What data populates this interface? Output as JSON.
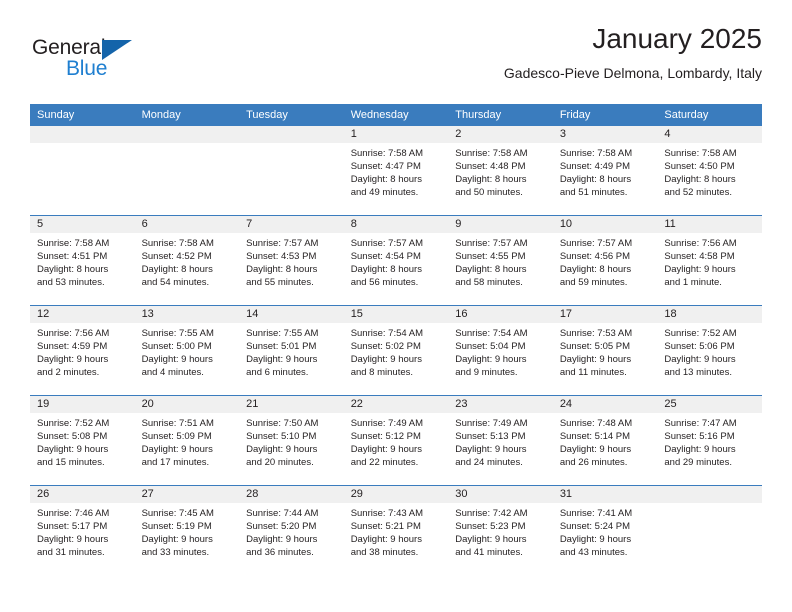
{
  "brand": {
    "name_part1": "General",
    "name_part2": "Blue",
    "triangle_color": "#1464aa",
    "blue_color": "#1f7fd0"
  },
  "header": {
    "title": "January 2025",
    "subtitle": "Gadesco-Pieve Delmona, Lombardy, Italy"
  },
  "theme": {
    "header_row_bg": "#3a7cbe",
    "daynum_bg": "#f0f0f0",
    "text_color": "#231f20"
  },
  "weekday_headers": [
    "Sunday",
    "Monday",
    "Tuesday",
    "Wednesday",
    "Thursday",
    "Friday",
    "Saturday"
  ],
  "weeks": [
    [
      {
        "day": "",
        "sunrise": "",
        "sunset": "",
        "daylight_line1": "",
        "daylight_line2": ""
      },
      {
        "day": "",
        "sunrise": "",
        "sunset": "",
        "daylight_line1": "",
        "daylight_line2": ""
      },
      {
        "day": "",
        "sunrise": "",
        "sunset": "",
        "daylight_line1": "",
        "daylight_line2": ""
      },
      {
        "day": "1",
        "sunrise": "Sunrise: 7:58 AM",
        "sunset": "Sunset: 4:47 PM",
        "daylight_line1": "Daylight: 8 hours",
        "daylight_line2": "and 49 minutes."
      },
      {
        "day": "2",
        "sunrise": "Sunrise: 7:58 AM",
        "sunset": "Sunset: 4:48 PM",
        "daylight_line1": "Daylight: 8 hours",
        "daylight_line2": "and 50 minutes."
      },
      {
        "day": "3",
        "sunrise": "Sunrise: 7:58 AM",
        "sunset": "Sunset: 4:49 PM",
        "daylight_line1": "Daylight: 8 hours",
        "daylight_line2": "and 51 minutes."
      },
      {
        "day": "4",
        "sunrise": "Sunrise: 7:58 AM",
        "sunset": "Sunset: 4:50 PM",
        "daylight_line1": "Daylight: 8 hours",
        "daylight_line2": "and 52 minutes."
      }
    ],
    [
      {
        "day": "5",
        "sunrise": "Sunrise: 7:58 AM",
        "sunset": "Sunset: 4:51 PM",
        "daylight_line1": "Daylight: 8 hours",
        "daylight_line2": "and 53 minutes."
      },
      {
        "day": "6",
        "sunrise": "Sunrise: 7:58 AM",
        "sunset": "Sunset: 4:52 PM",
        "daylight_line1": "Daylight: 8 hours",
        "daylight_line2": "and 54 minutes."
      },
      {
        "day": "7",
        "sunrise": "Sunrise: 7:57 AM",
        "sunset": "Sunset: 4:53 PM",
        "daylight_line1": "Daylight: 8 hours",
        "daylight_line2": "and 55 minutes."
      },
      {
        "day": "8",
        "sunrise": "Sunrise: 7:57 AM",
        "sunset": "Sunset: 4:54 PM",
        "daylight_line1": "Daylight: 8 hours",
        "daylight_line2": "and 56 minutes."
      },
      {
        "day": "9",
        "sunrise": "Sunrise: 7:57 AM",
        "sunset": "Sunset: 4:55 PM",
        "daylight_line1": "Daylight: 8 hours",
        "daylight_line2": "and 58 minutes."
      },
      {
        "day": "10",
        "sunrise": "Sunrise: 7:57 AM",
        "sunset": "Sunset: 4:56 PM",
        "daylight_line1": "Daylight: 8 hours",
        "daylight_line2": "and 59 minutes."
      },
      {
        "day": "11",
        "sunrise": "Sunrise: 7:56 AM",
        "sunset": "Sunset: 4:58 PM",
        "daylight_line1": "Daylight: 9 hours",
        "daylight_line2": "and 1 minute."
      }
    ],
    [
      {
        "day": "12",
        "sunrise": "Sunrise: 7:56 AM",
        "sunset": "Sunset: 4:59 PM",
        "daylight_line1": "Daylight: 9 hours",
        "daylight_line2": "and 2 minutes."
      },
      {
        "day": "13",
        "sunrise": "Sunrise: 7:55 AM",
        "sunset": "Sunset: 5:00 PM",
        "daylight_line1": "Daylight: 9 hours",
        "daylight_line2": "and 4 minutes."
      },
      {
        "day": "14",
        "sunrise": "Sunrise: 7:55 AM",
        "sunset": "Sunset: 5:01 PM",
        "daylight_line1": "Daylight: 9 hours",
        "daylight_line2": "and 6 minutes."
      },
      {
        "day": "15",
        "sunrise": "Sunrise: 7:54 AM",
        "sunset": "Sunset: 5:02 PM",
        "daylight_line1": "Daylight: 9 hours",
        "daylight_line2": "and 8 minutes."
      },
      {
        "day": "16",
        "sunrise": "Sunrise: 7:54 AM",
        "sunset": "Sunset: 5:04 PM",
        "daylight_line1": "Daylight: 9 hours",
        "daylight_line2": "and 9 minutes."
      },
      {
        "day": "17",
        "sunrise": "Sunrise: 7:53 AM",
        "sunset": "Sunset: 5:05 PM",
        "daylight_line1": "Daylight: 9 hours",
        "daylight_line2": "and 11 minutes."
      },
      {
        "day": "18",
        "sunrise": "Sunrise: 7:52 AM",
        "sunset": "Sunset: 5:06 PM",
        "daylight_line1": "Daylight: 9 hours",
        "daylight_line2": "and 13 minutes."
      }
    ],
    [
      {
        "day": "19",
        "sunrise": "Sunrise: 7:52 AM",
        "sunset": "Sunset: 5:08 PM",
        "daylight_line1": "Daylight: 9 hours",
        "daylight_line2": "and 15 minutes."
      },
      {
        "day": "20",
        "sunrise": "Sunrise: 7:51 AM",
        "sunset": "Sunset: 5:09 PM",
        "daylight_line1": "Daylight: 9 hours",
        "daylight_line2": "and 17 minutes."
      },
      {
        "day": "21",
        "sunrise": "Sunrise: 7:50 AM",
        "sunset": "Sunset: 5:10 PM",
        "daylight_line1": "Daylight: 9 hours",
        "daylight_line2": "and 20 minutes."
      },
      {
        "day": "22",
        "sunrise": "Sunrise: 7:49 AM",
        "sunset": "Sunset: 5:12 PM",
        "daylight_line1": "Daylight: 9 hours",
        "daylight_line2": "and 22 minutes."
      },
      {
        "day": "23",
        "sunrise": "Sunrise: 7:49 AM",
        "sunset": "Sunset: 5:13 PM",
        "daylight_line1": "Daylight: 9 hours",
        "daylight_line2": "and 24 minutes."
      },
      {
        "day": "24",
        "sunrise": "Sunrise: 7:48 AM",
        "sunset": "Sunset: 5:14 PM",
        "daylight_line1": "Daylight: 9 hours",
        "daylight_line2": "and 26 minutes."
      },
      {
        "day": "25",
        "sunrise": "Sunrise: 7:47 AM",
        "sunset": "Sunset: 5:16 PM",
        "daylight_line1": "Daylight: 9 hours",
        "daylight_line2": "and 29 minutes."
      }
    ],
    [
      {
        "day": "26",
        "sunrise": "Sunrise: 7:46 AM",
        "sunset": "Sunset: 5:17 PM",
        "daylight_line1": "Daylight: 9 hours",
        "daylight_line2": "and 31 minutes."
      },
      {
        "day": "27",
        "sunrise": "Sunrise: 7:45 AM",
        "sunset": "Sunset: 5:19 PM",
        "daylight_line1": "Daylight: 9 hours",
        "daylight_line2": "and 33 minutes."
      },
      {
        "day": "28",
        "sunrise": "Sunrise: 7:44 AM",
        "sunset": "Sunset: 5:20 PM",
        "daylight_line1": "Daylight: 9 hours",
        "daylight_line2": "and 36 minutes."
      },
      {
        "day": "29",
        "sunrise": "Sunrise: 7:43 AM",
        "sunset": "Sunset: 5:21 PM",
        "daylight_line1": "Daylight: 9 hours",
        "daylight_line2": "and 38 minutes."
      },
      {
        "day": "30",
        "sunrise": "Sunrise: 7:42 AM",
        "sunset": "Sunset: 5:23 PM",
        "daylight_line1": "Daylight: 9 hours",
        "daylight_line2": "and 41 minutes."
      },
      {
        "day": "31",
        "sunrise": "Sunrise: 7:41 AM",
        "sunset": "Sunset: 5:24 PM",
        "daylight_line1": "Daylight: 9 hours",
        "daylight_line2": "and 43 minutes."
      },
      {
        "day": "",
        "sunrise": "",
        "sunset": "",
        "daylight_line1": "",
        "daylight_line2": ""
      }
    ]
  ]
}
